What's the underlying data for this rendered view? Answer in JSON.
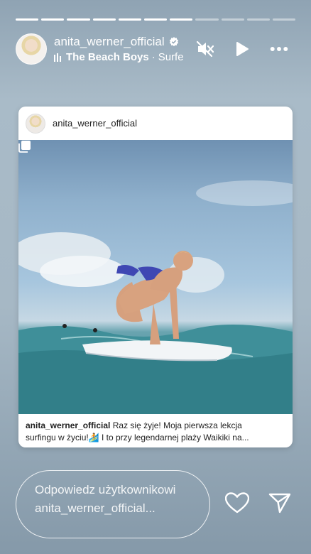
{
  "story": {
    "segments_total": 11,
    "segments_viewed": 7
  },
  "header": {
    "username": "anita_werner_official",
    "music_artist": "The Beach Boys",
    "music_separator": "·",
    "music_title": "Surfe",
    "icons": [
      "verified-icon",
      "music-bars-icon",
      "mute-icon",
      "play-icon",
      "more-icon"
    ]
  },
  "post": {
    "username": "anita_werner_official",
    "caption_user": "anita_werner_official",
    "caption_line1": "Raz się żyje! Moja pierwsza lekcja",
    "caption_line2": "surfingu w życiu!🏄 I to przy legendarnej plaży Waikiki na...",
    "icons": [
      "multiple-photos-icon"
    ]
  },
  "footer": {
    "reply_placeholder": "Odpowiedz użytkownikowi anita_werner_official...",
    "icons": [
      "heart-icon",
      "send-icon"
    ]
  }
}
